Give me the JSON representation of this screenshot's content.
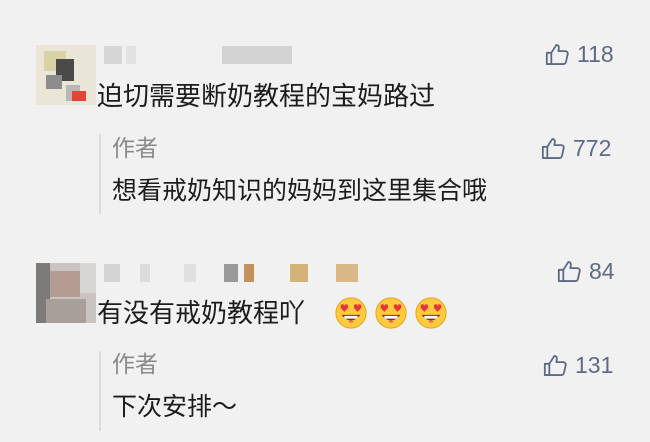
{
  "comments": [
    {
      "likes": "118",
      "text": "迫切需要断奶教程的宝妈路过",
      "reply": {
        "author": "作者",
        "likes": "772",
        "text": "想看戒奶知识的妈妈到这里集合哦"
      }
    },
    {
      "likes": "84",
      "text": "有没有戒奶教程吖",
      "emoji_count": 3,
      "reply": {
        "author": "作者",
        "likes": "131",
        "text": "下次安排～"
      }
    }
  ],
  "icons": {
    "like": "thumbs-up-icon",
    "emoji": "heart-eyes-emoji-icon"
  },
  "colors": {
    "background": "#f1f1f1",
    "like_icon": "#5a6a85",
    "author_label": "#8a8a8a"
  }
}
